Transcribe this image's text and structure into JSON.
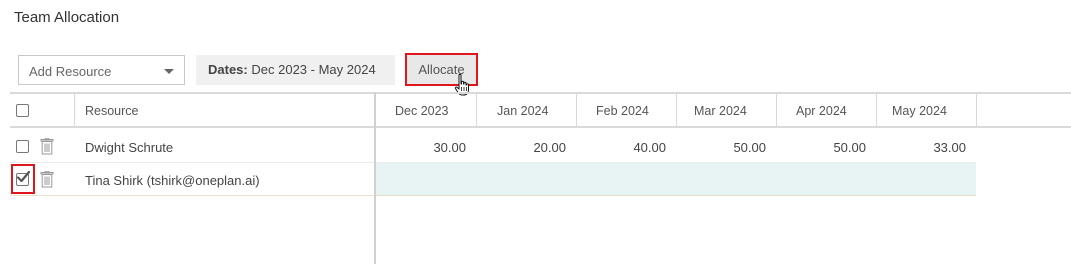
{
  "page": {
    "title": "Team Allocation"
  },
  "toolbar": {
    "add_resource_placeholder": "Add Resource",
    "dates_label": "Dates:",
    "dates_value": "Dec 2023 - May 2024",
    "allocate_label": "Allocate"
  },
  "grid": {
    "resource_header": "Resource",
    "months": [
      "Dec 2023",
      "Jan 2024",
      "Feb 2024",
      "Mar 2024",
      "Apr 2024",
      "May 2024"
    ],
    "rows": [
      {
        "name": "Dwight Schrute",
        "checked": false,
        "values": [
          "30.00",
          "20.00",
          "40.00",
          "50.00",
          "50.00",
          "33.00"
        ]
      },
      {
        "name": "Tina Shirk (tshirk@oneplan.ai)",
        "checked": true,
        "values": [
          "",
          "",
          "",
          "",
          "",
          ""
        ]
      }
    ]
  },
  "colors": {
    "highlight": "#e0161f",
    "selected_row": "#e8f3f4"
  }
}
